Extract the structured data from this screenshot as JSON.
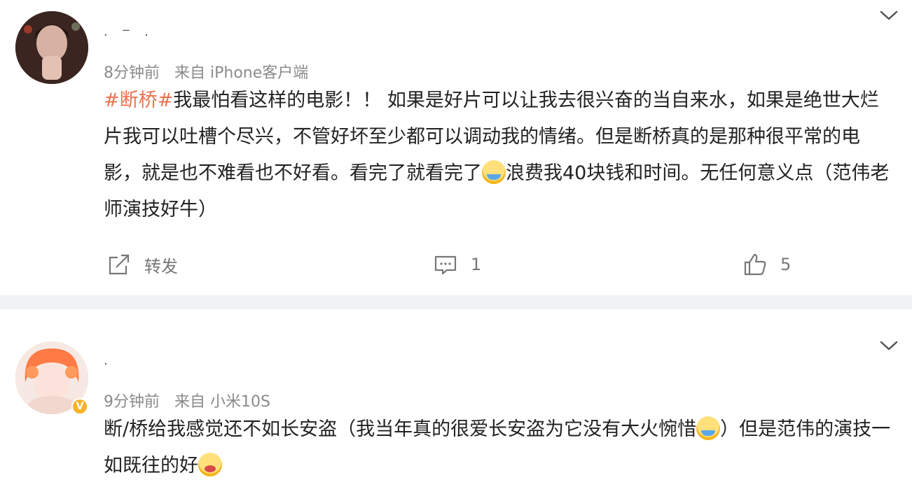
{
  "post1": {
    "username": "·  ‾  ·",
    "time": "8分钟前",
    "source": "来自 iPhone客户端",
    "hashtag": "#断桥#",
    "text_before": "我最怕看这样的电影！！ 如果是好片可以让我去很兴奋的当自来水，如果是绝世大烂片我可以吐槽个尽兴，不管好坏至少都可以调动我的情绪。但是断桥真的是那种很平常的电影，就是也不难看也不好看。看完了就看完了",
    "text_after": "浪费我40块钱和时间。无任何意义点（范伟老师演技好牛）",
    "emoji_name": "sweat-emoji",
    "repost_label": "转发",
    "comment_count": "1",
    "like_count": "5"
  },
  "post2": {
    "username": "·",
    "time": "9分钟前",
    "source": "来自 小米10S",
    "text_before": "断/桥给我感觉还不如长安盗（我当年真的很爱长安盗为它没有大火惋惜",
    "text_middle": "）但是范伟的演技一如既往的好",
    "emoji_1": "crying-emoji",
    "emoji_2": "shocked-emoji"
  },
  "colors": {
    "hashtag": "#eb7350",
    "separator": "#f1f2f4",
    "meta_text": "#8b8b8b"
  }
}
